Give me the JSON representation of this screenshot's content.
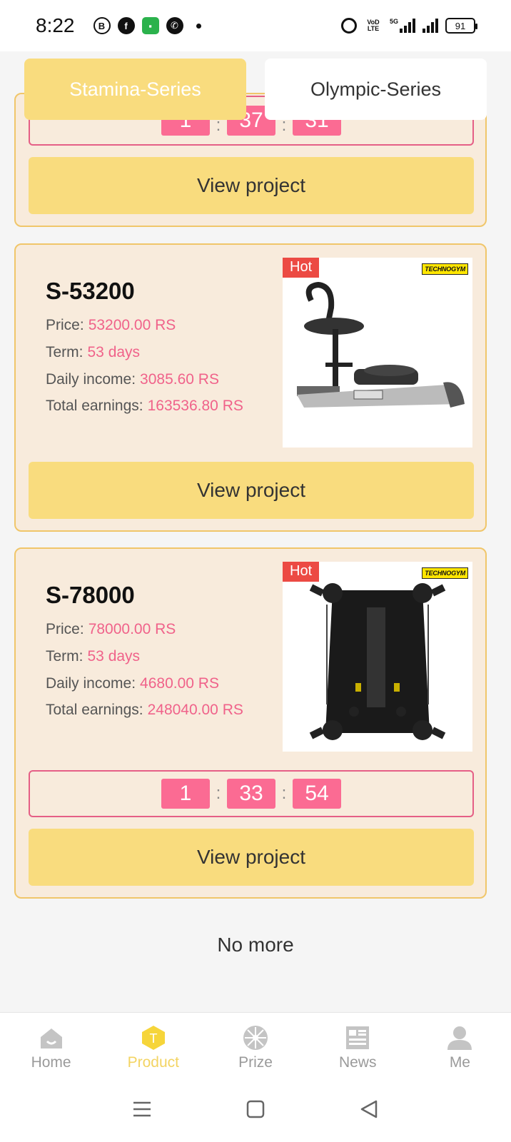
{
  "status_bar": {
    "time": "8:22",
    "signal_label": "5G",
    "vo_label": "VoD LTE",
    "battery": "91"
  },
  "tabs": [
    {
      "label": "Stamina-Series",
      "active": true
    },
    {
      "label": "Olympic-Series",
      "active": false
    }
  ],
  "partial_card": {
    "timer": [
      "1",
      "37",
      "31"
    ],
    "button": "View project"
  },
  "products": [
    {
      "name": "S-53200",
      "price_label": "Price:",
      "price": "53200.00 RS",
      "term_label": "Term:",
      "term": "53 days",
      "daily_label": "Daily income:",
      "daily": "3085.60 RS",
      "total_label": "Total earnings:",
      "total": "163536.80 RS",
      "badge": "Hot",
      "brand": "TECHNOGYM",
      "button": "View project"
    },
    {
      "name": "S-78000",
      "price_label": "Price:",
      "price": "78000.00 RS",
      "term_label": "Term:",
      "term": "53 days",
      "daily_label": "Daily income:",
      "daily": "4680.00 RS",
      "total_label": "Total earnings:",
      "total": "248040.00 RS",
      "badge": "Hot",
      "brand": "TECHNOGYM",
      "timer": [
        "1",
        "33",
        "54"
      ],
      "button": "View project"
    }
  ],
  "footer_text": "No more",
  "nav": [
    {
      "label": "Home",
      "icon": "home-icon"
    },
    {
      "label": "Product",
      "icon": "product-icon",
      "active": true
    },
    {
      "label": "Prize",
      "icon": "prize-wheel-icon"
    },
    {
      "label": "News",
      "icon": "news-icon"
    },
    {
      "label": "Me",
      "icon": "user-icon"
    }
  ],
  "colors": {
    "accent_yellow": "#f9dc7e",
    "card_bg": "#f8ebdc",
    "value_pink": "#f0628a",
    "hot_red": "#ec4a43"
  }
}
